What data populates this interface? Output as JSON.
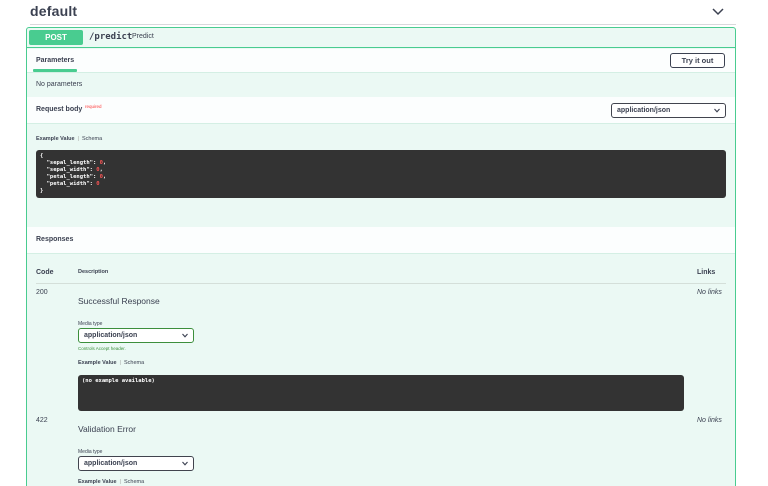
{
  "tag": {
    "title": "default"
  },
  "operation": {
    "method": "POST",
    "path": "/predict",
    "summary": "Predict"
  },
  "parameters": {
    "tab_label": "Parameters",
    "try_button": "Try it out",
    "empty_text": "No parameters"
  },
  "request_body": {
    "label": "Request body",
    "required": "required",
    "content_type": "application/json",
    "tab_example": "Example Value",
    "tab_schema": "Schema",
    "example": {
      "open": "{",
      "close": "}",
      "fields": [
        {
          "key": "\"sepal_length\"",
          "value": "0",
          "sep": ","
        },
        {
          "key": "\"sepal_width\"",
          "value": "0",
          "sep": ","
        },
        {
          "key": "\"petal_length\"",
          "value": "0",
          "sep": ","
        },
        {
          "key": "\"petal_width\"",
          "value": "0",
          "sep": ""
        }
      ]
    }
  },
  "responses": {
    "title": "Responses",
    "headers": {
      "code": "Code",
      "description": "Description",
      "links": "Links"
    },
    "items": [
      {
        "code": "200",
        "description": "Successful Response",
        "links": "No links",
        "media_label": "Media type",
        "media_type": "application/json",
        "controls": "Controls Accept header.",
        "tab_example": "Example Value",
        "tab_schema": "Schema",
        "example": "(no example available)"
      },
      {
        "code": "422",
        "description": "Validation Error",
        "links": "No links",
        "media_label": "Media type",
        "media_type": "application/json",
        "tab_example": "Example Value",
        "tab_schema": "Schema"
      }
    ]
  },
  "colors": {
    "post_accent": "#49cc90",
    "block_bg": "#ebf9f4",
    "code_bg": "#333333",
    "required_red": "#ff3b3b",
    "accepted_green": "#3c8f3c"
  }
}
